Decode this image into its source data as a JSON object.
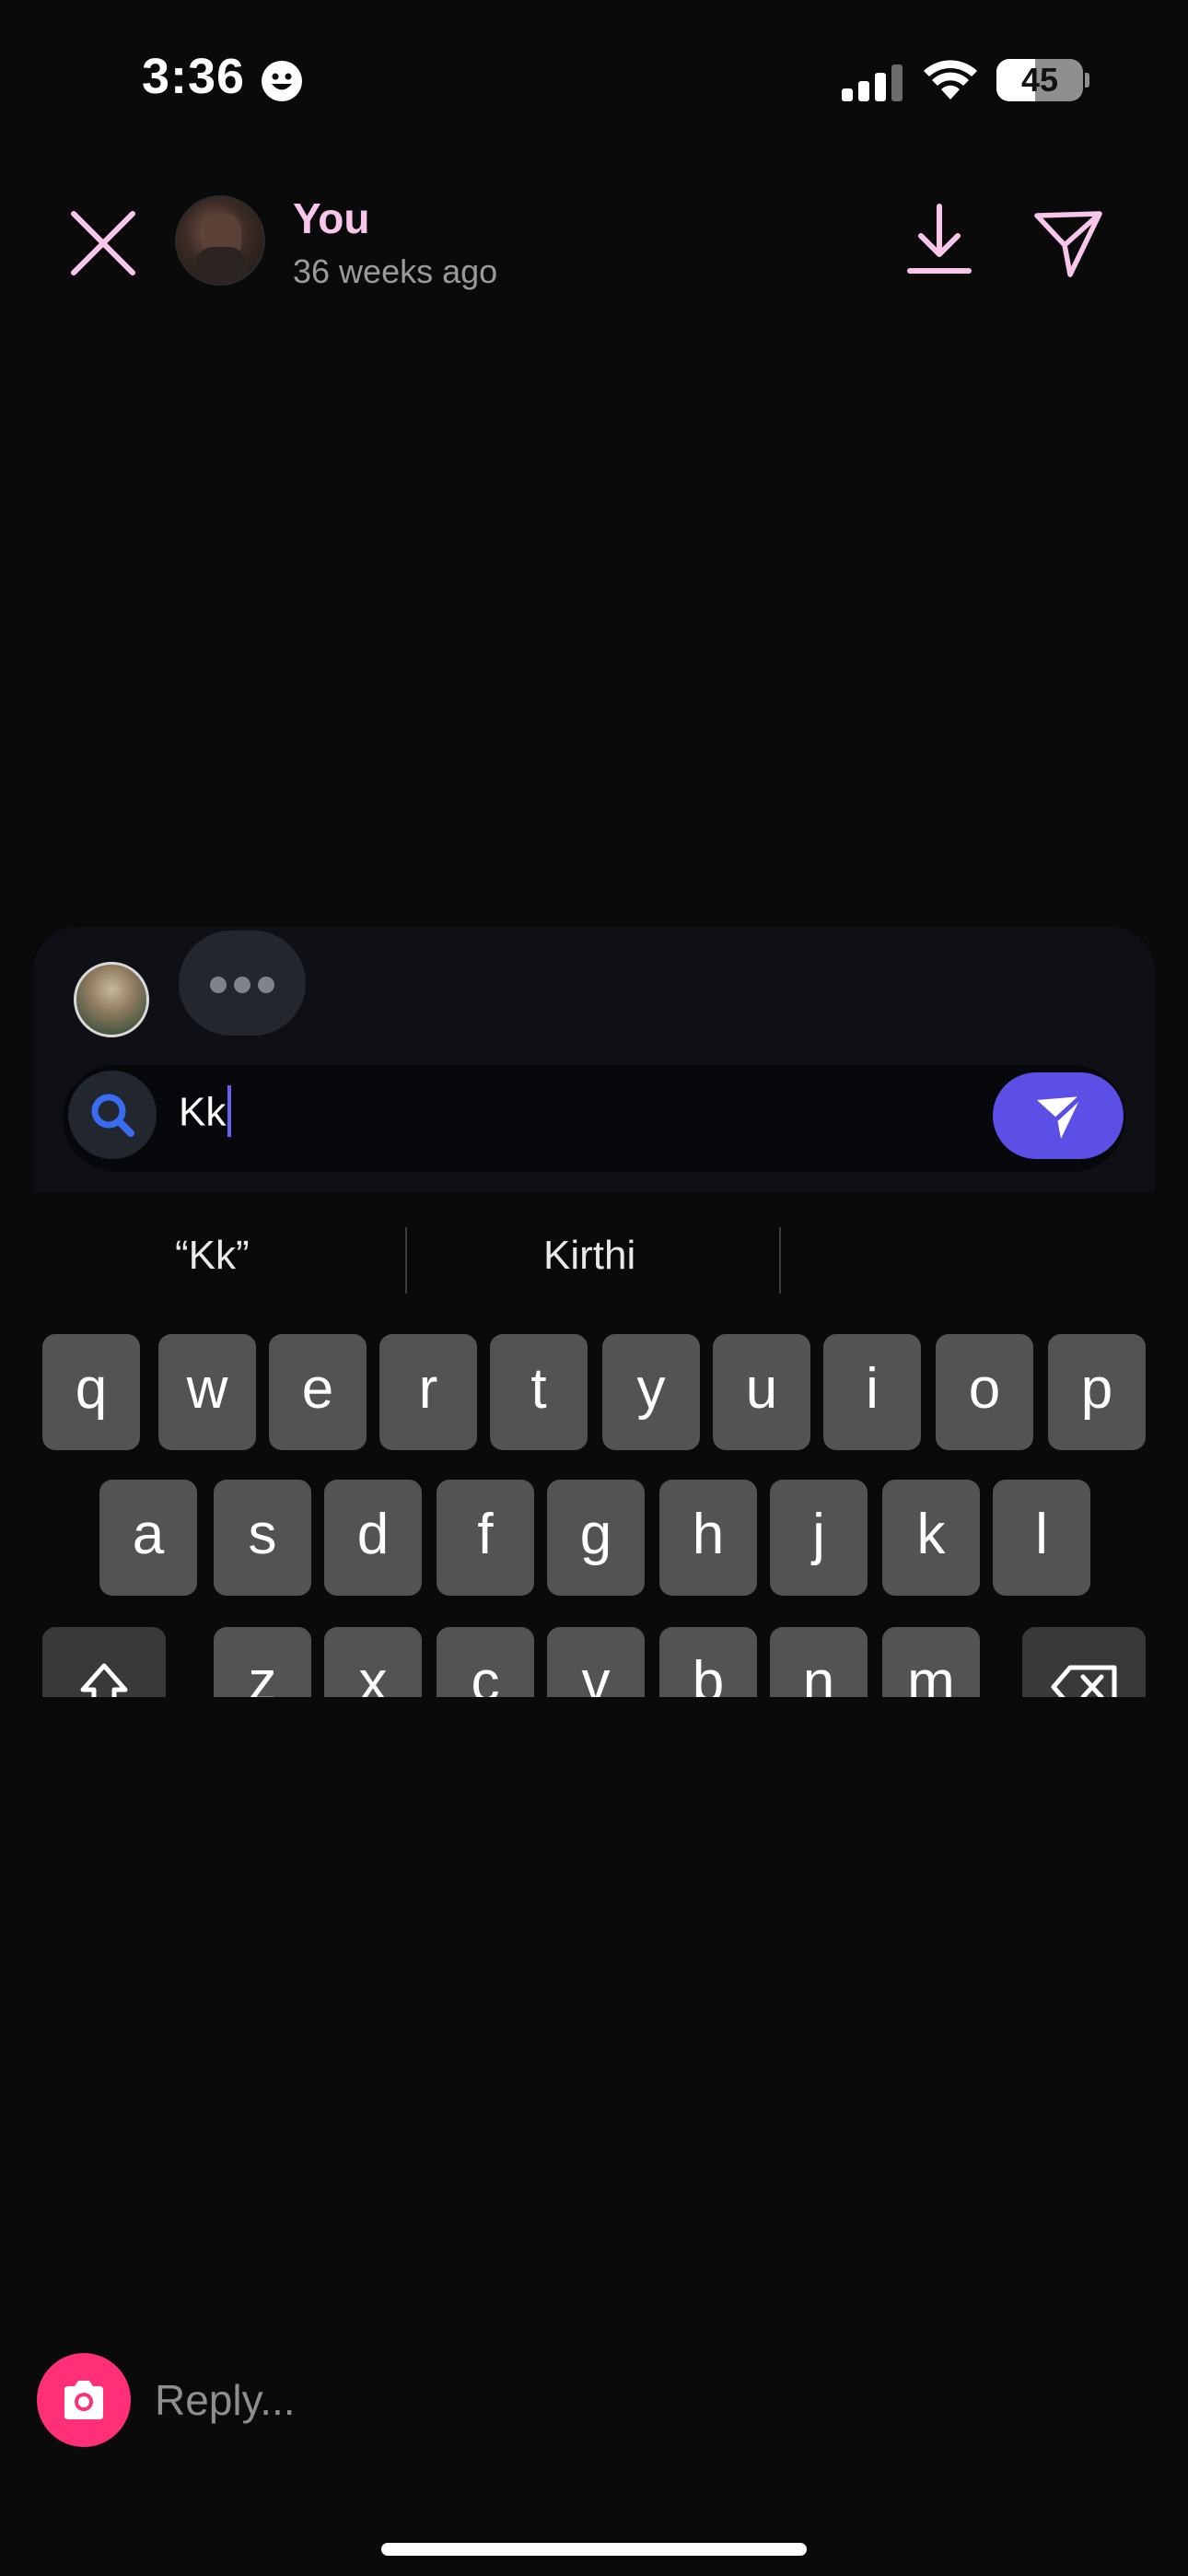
{
  "status_bar": {
    "time": "3:36",
    "battery": "45"
  },
  "header": {
    "user_name": "You",
    "posted_time": "36 weeks ago"
  },
  "share_panel": {
    "search": {
      "value": "Kk",
      "placeholder": ""
    }
  },
  "keyboard": {
    "suggestions": [
      "“Kk”",
      "Kirthi",
      ""
    ],
    "row1": [
      "q",
      "w",
      "e",
      "r",
      "t",
      "y",
      "u",
      "i",
      "o",
      "p"
    ],
    "row2": [
      "a",
      "s",
      "d",
      "f",
      "g",
      "h",
      "j",
      "k",
      "l"
    ],
    "row3": [
      "z",
      "x",
      "c",
      "v",
      "b",
      "n",
      "m"
    ]
  },
  "reply": {
    "placeholder": "Reply..."
  },
  "colors": {
    "accent": "#5b4fe6",
    "name_pink": "#f7c6ea",
    "camera_pink": "#ff2f78",
    "search_blue": "#3a6cf0"
  }
}
